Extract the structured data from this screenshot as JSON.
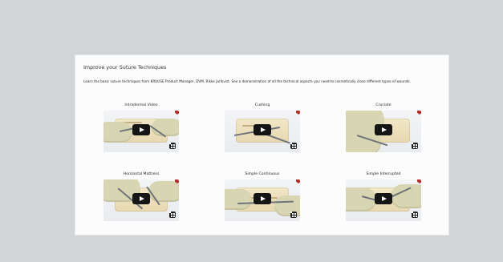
{
  "section": {
    "title": "Improve your Suture Techniques",
    "description": "Learn the basic suture techniques from KRUUSE Product Manager, DVM, Rikke Jarlkvist. See a demonstration of all the technical aspects you need to cosmetically close different types of wounds."
  },
  "videos": [
    {
      "title": "Intradermal Video"
    },
    {
      "title": "Cushing"
    },
    {
      "title": "Cruciate"
    },
    {
      "title": "Horizontal Mattress"
    },
    {
      "title": "Simple Continuous"
    },
    {
      "title": "Simple Interrupted"
    }
  ],
  "colors": {
    "background": "#d2d5d8",
    "card": "#fcfcfc",
    "play": "#151515",
    "accent": "#b52e2b"
  },
  "icons": {
    "play": "play-icon",
    "expand": "expand-icon",
    "brand": "brand-icon"
  }
}
